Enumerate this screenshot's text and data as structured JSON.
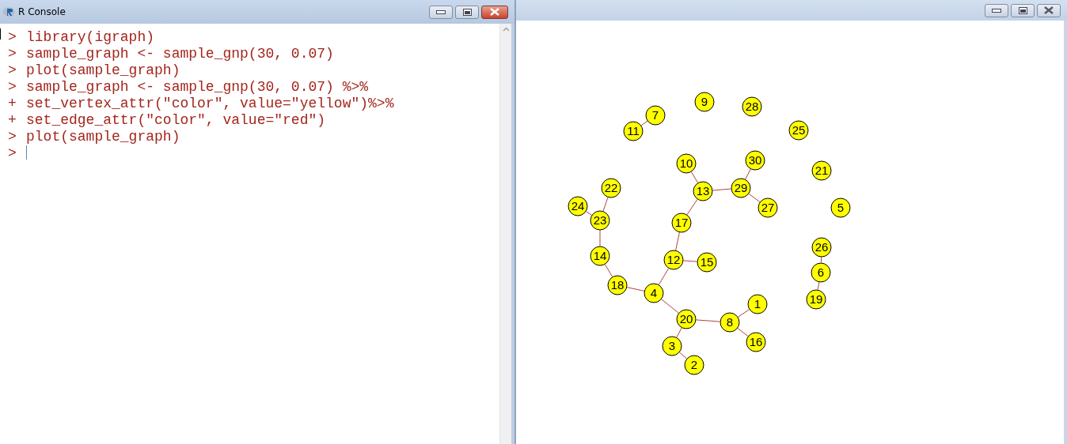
{
  "console_window": {
    "title": "R Console",
    "lines": [
      {
        "prompt": ">",
        "code": "library(igraph)"
      },
      {
        "prompt": ">",
        "code": "sample_graph <- sample_gnp(30, 0.07)"
      },
      {
        "prompt": ">",
        "code": "plot(sample_graph)"
      },
      {
        "prompt": ">",
        "code": "sample_graph <- sample_gnp(30, 0.07) %>%"
      },
      {
        "prompt": "+",
        "code": "set_vertex_attr(\"color\", value=\"yellow\")%>%"
      },
      {
        "prompt": "+",
        "code": "set_edge_attr(\"color\", value=\"red\")"
      },
      {
        "prompt": ">",
        "code": "plot(sample_graph)"
      }
    ],
    "input_prompt": ">"
  },
  "graph_window": {
    "vertices": [
      {
        "label": "7"
      },
      {
        "label": "9"
      },
      {
        "label": "28"
      },
      {
        "label": "11"
      },
      {
        "label": "25"
      },
      {
        "label": "10"
      },
      {
        "label": "30"
      },
      {
        "label": "21"
      },
      {
        "label": "22"
      },
      {
        "label": "13"
      },
      {
        "label": "29"
      },
      {
        "label": "24"
      },
      {
        "label": "27"
      },
      {
        "label": "5"
      },
      {
        "label": "23"
      },
      {
        "label": "17"
      },
      {
        "label": "26"
      },
      {
        "label": "14"
      },
      {
        "label": "12"
      },
      {
        "label": "15"
      },
      {
        "label": "6"
      },
      {
        "label": "18"
      },
      {
        "label": "4"
      },
      {
        "label": "1"
      },
      {
        "label": "19"
      },
      {
        "label": "20"
      },
      {
        "label": "8"
      },
      {
        "label": "3"
      },
      {
        "label": "16"
      },
      {
        "label": "2"
      }
    ]
  }
}
